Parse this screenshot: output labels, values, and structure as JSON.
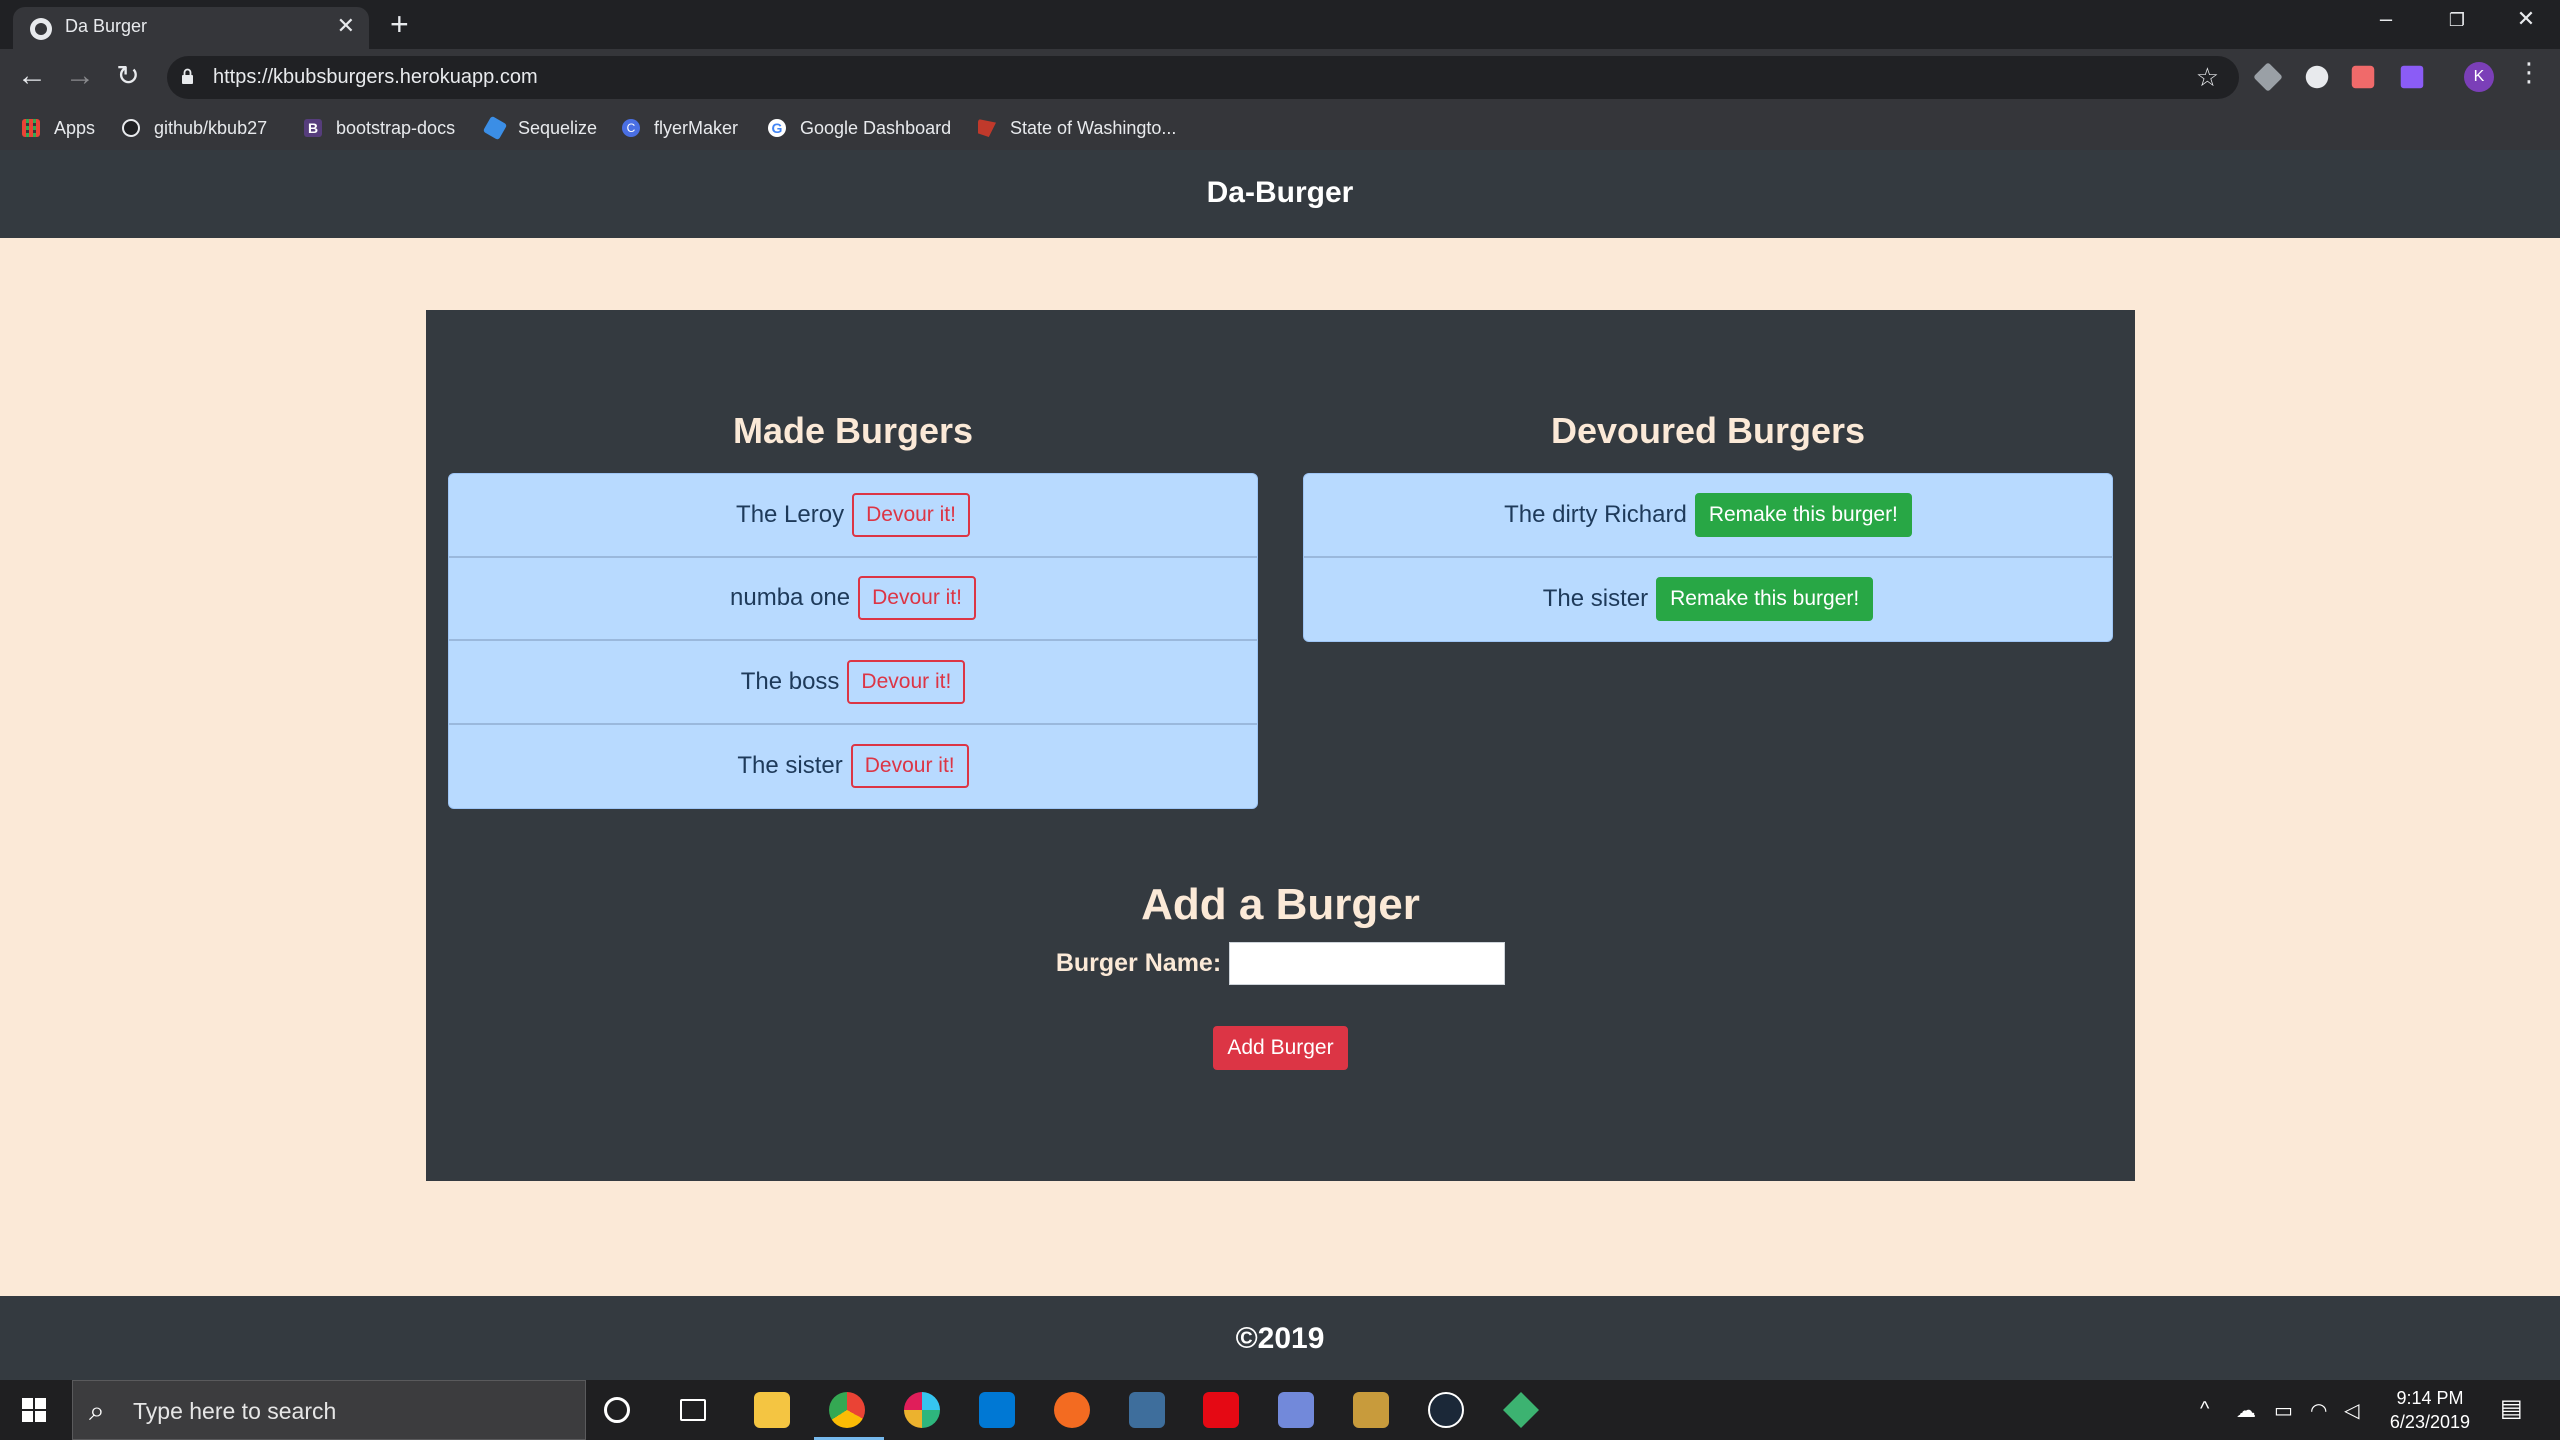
{
  "browser": {
    "tab_title": "Da Burger",
    "tab_close": "✕",
    "new_tab": "+",
    "url": "https://kbubsburgers.herokuapp.com",
    "profile_initial": "K",
    "bookmarks": [
      "Apps",
      "github/kbub27",
      "bootstrap-docs",
      "Sequelize",
      "flyerMaker",
      "Google Dashboard",
      "State of Washingto..."
    ]
  },
  "header": {
    "title": "Da-Burger"
  },
  "made": {
    "title": "Made Burgers",
    "items": [
      {
        "name": "The Leroy",
        "action": "Devour it!"
      },
      {
        "name": "numba one",
        "action": "Devour it!"
      },
      {
        "name": "The boss",
        "action": "Devour it!"
      },
      {
        "name": "The sister",
        "action": "Devour it!"
      }
    ]
  },
  "devoured": {
    "title": "Devoured Burgers",
    "items": [
      {
        "name": "The dirty Richard",
        "action": "Remake this burger!"
      },
      {
        "name": "The sister",
        "action": "Remake this burger!"
      }
    ]
  },
  "add": {
    "title": "Add a Burger",
    "label": "Burger Name:",
    "input_value": "",
    "button": "Add Burger"
  },
  "footer": {
    "text": "©2019"
  },
  "taskbar": {
    "search_placeholder": "Type here to search",
    "time": "9:14 PM",
    "date": "6/23/2019"
  },
  "colors": {
    "page_bg": "#fbe9d7",
    "dark": "#343a40",
    "list_bg": "#b8daff",
    "danger": "#dc3545",
    "success": "#28a745"
  }
}
